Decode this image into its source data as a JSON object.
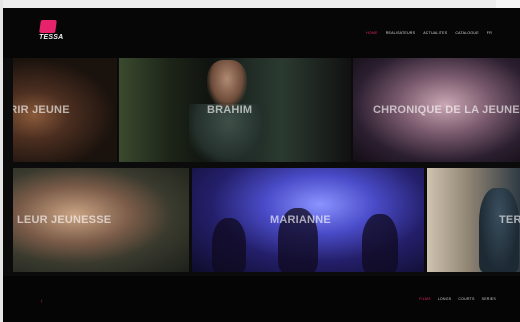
{
  "header": {
    "logo_text": "TESSA",
    "nav": [
      {
        "label": "Home",
        "active": true
      },
      {
        "label": "Realisateurs",
        "active": false
      },
      {
        "label": "Actualites",
        "active": false
      },
      {
        "label": "Catalogue",
        "active": false
      },
      {
        "label": "FR",
        "active": false
      }
    ]
  },
  "films": [
    {
      "title": "MOURIR JEUNE"
    },
    {
      "title": "BRAHIM"
    },
    {
      "title": "CHRONIQUE DE LA JEUNESSE"
    },
    {
      "title": "LEUR JEUNESSE"
    },
    {
      "title": "MARIANNE"
    },
    {
      "title": "TERRE"
    }
  ],
  "footer": {
    "mark": "|",
    "nav": [
      {
        "label": "Films",
        "active": true
      },
      {
        "label": "Longs",
        "active": false
      },
      {
        "label": "Courts",
        "active": false
      },
      {
        "label": "Series",
        "active": false
      }
    ]
  },
  "colors": {
    "accent": "#e6236b",
    "background": "#0b0b0c"
  }
}
